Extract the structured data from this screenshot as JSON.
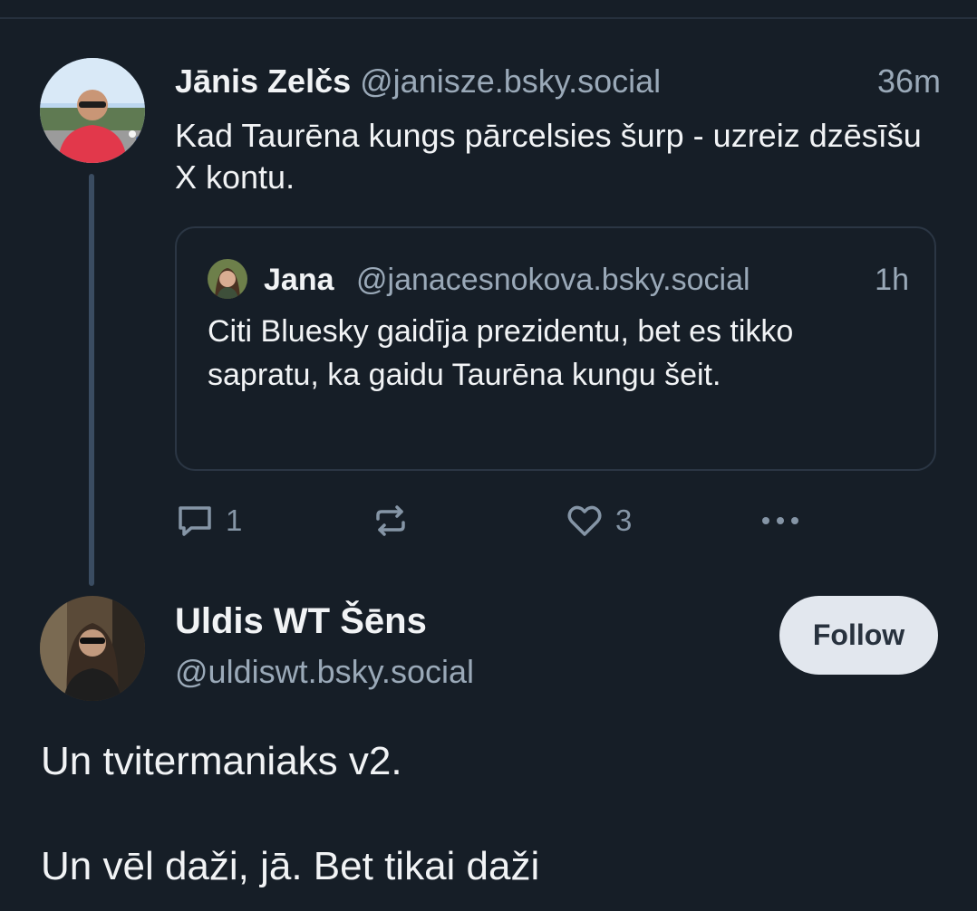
{
  "post": {
    "author_name": "Jānis Zelčs",
    "author_handle": "@janisze.bsky.social",
    "time": "36m",
    "text": "Kad Taurēna kungs pārcelsies šurp - uzreiz dzēsīšu X kontu.",
    "avatar_icon": "person-photo-avatar",
    "quote": {
      "author_name": "Jana",
      "author_handle": "@janacesnokova.bsky.social",
      "time": "1h",
      "text": "Citi Bluesky gaidīja prezidentu, bet es tikko sapratu, ka gaidu Taurēna kungu šeit."
    },
    "actions": {
      "reply_icon": "speech-bubble-icon",
      "reply_count": "1",
      "repost_icon": "repost-icon",
      "like_icon": "heart-icon",
      "like_count": "3",
      "more_icon": "more-dots-icon"
    }
  },
  "reply": {
    "author_name": "Uldis WT Šēns",
    "author_handle": "@uldiswt.bsky.social",
    "follow_label": "Follow",
    "text_line1": "Un tvitermaniaks v2.",
    "text_line2": "Un vēl daži, jā. Bet tikai daži"
  },
  "colors": {
    "background": "#161e27",
    "text": "#f1f3f5",
    "muted": "#9aa9b8",
    "thread_line": "#3a4c61",
    "follow_bg": "#e2e7ee"
  }
}
